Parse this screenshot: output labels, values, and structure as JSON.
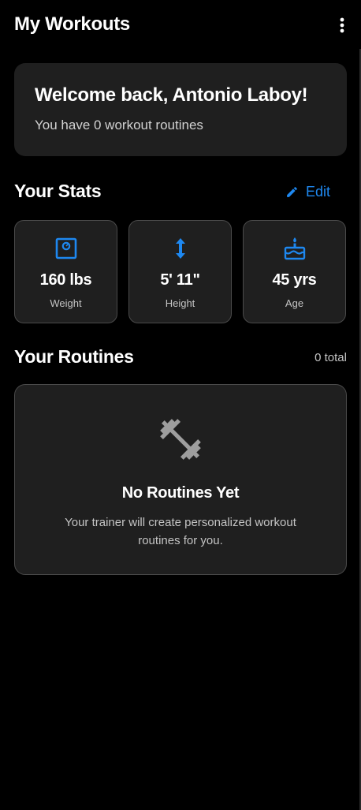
{
  "app_bar": {
    "title": "My Workouts",
    "menu_icon": "more-vert-icon"
  },
  "welcome": {
    "title": "Welcome back, Antonio Laboy!",
    "subtitle": "You have 0 workout routines"
  },
  "stats": {
    "section_title": "Your Stats",
    "edit_label": "Edit",
    "edit_icon": "pencil-icon",
    "items": [
      {
        "value": "160 lbs",
        "label": "Weight",
        "icon": "scale-icon"
      },
      {
        "value": "5' 11\"",
        "label": "Height",
        "icon": "height-arrows-icon"
      },
      {
        "value": "45 yrs",
        "label": "Age",
        "icon": "cake-icon"
      }
    ]
  },
  "routines": {
    "section_title": "Your Routines",
    "total": "0 total",
    "empty": {
      "icon": "dumbbell-icon",
      "title": "No Routines Yet",
      "description": "Your trainer will create personalized workout routines for you."
    }
  },
  "colors": {
    "background": "#000000",
    "card": "#1f1f1f",
    "accent": "#1e88f0",
    "muted_text": "#c4c4c4",
    "icon_gray": "#9e9e9e"
  }
}
